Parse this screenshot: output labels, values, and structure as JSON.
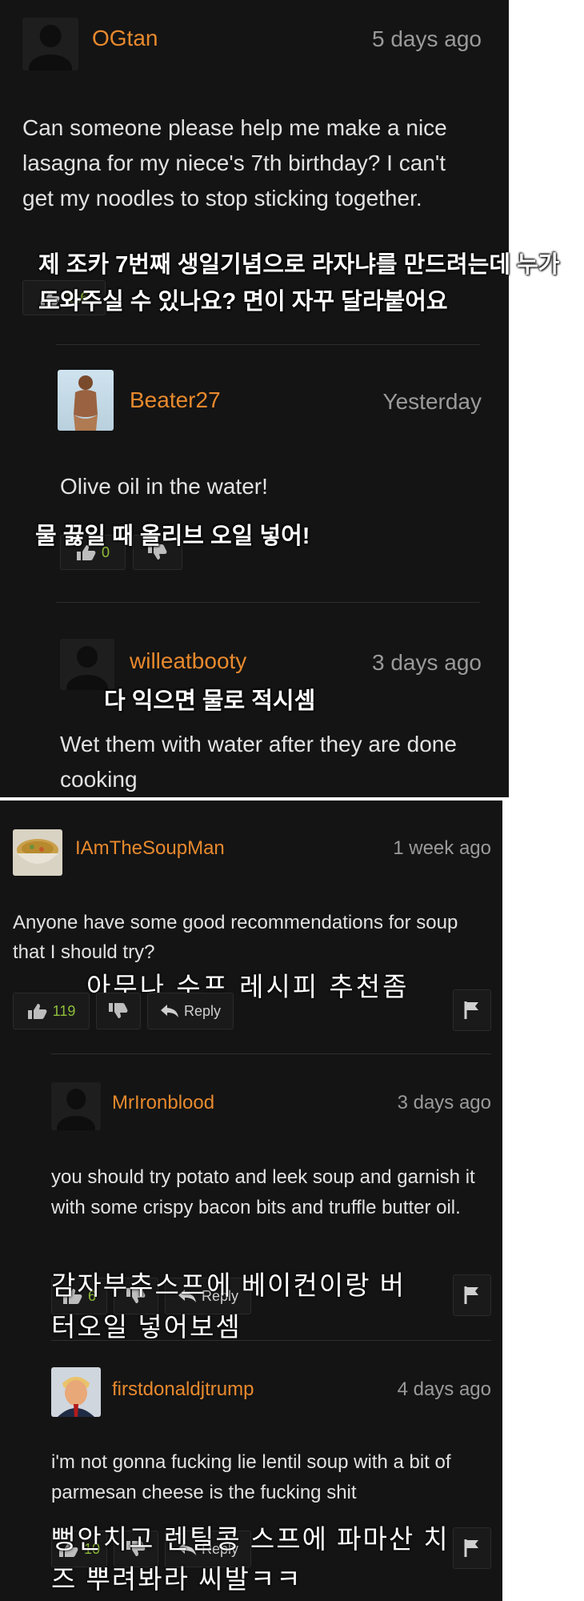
{
  "thread1": {
    "comment": {
      "username": "OGtan",
      "timestamp": "5 days ago",
      "text": "Can someone please help me make a nice lasagna for my niece's 7th birthday? I can't get my noodles to stop sticking together.",
      "translation": "제 조카 7번째 생일기념으로 라자냐를 만드려는데 누가 도와주실 수 있나요? 면이 자꾸 달라붙어요",
      "votes": "116"
    },
    "reply1": {
      "username": "Beater27",
      "timestamp": "Yesterday",
      "text": "Olive oil in the water!",
      "translation": "물 끓일 때 올리브 오일 넣어!",
      "votes": "0"
    },
    "reply2": {
      "username": "willeatbooty",
      "timestamp": "3 days ago",
      "text": "Wet them with water after they are done cooking",
      "translation": "다 익으면 물로 적시셈"
    }
  },
  "thread2": {
    "comment": {
      "username": "IAmTheSoupMan",
      "timestamp": "1 week ago",
      "text": "Anyone have some good recommendations for soup that I should try?",
      "translation": "아무나 수프 레시피 추천좀",
      "votes": "119",
      "reply_label": "Reply"
    },
    "reply1": {
      "username": "MrIronblood",
      "timestamp": "3 days ago",
      "text": "you should try potato and leek soup and garnish it with some crispy bacon bits and truffle butter oil.",
      "translation": "감자부추스프에 베이컨이랑 버터오일 넣어보셈",
      "votes": "6",
      "reply_label": "Reply"
    },
    "reply2": {
      "username": "firstdonaldjtrump",
      "timestamp": "4 days ago",
      "text": "i'm not gonna fucking lie lentil soup with a bit of parmesan cheese is the fucking shit",
      "translation": "뻥안치고 렌틸콩 스프에 파마산 치즈 뿌려봐라 씨발ㅋㅋ",
      "votes": "10",
      "reply_label": "Reply"
    }
  },
  "icons": [
    "thumbs-up-icon",
    "thumbs-down-icon",
    "reply-arrow-icon",
    "flag-icon"
  ],
  "colors": {
    "background": "#141414",
    "username": "#e8892d",
    "timestamp": "#9a9a9a",
    "vote_count": "#8fbf3a"
  }
}
